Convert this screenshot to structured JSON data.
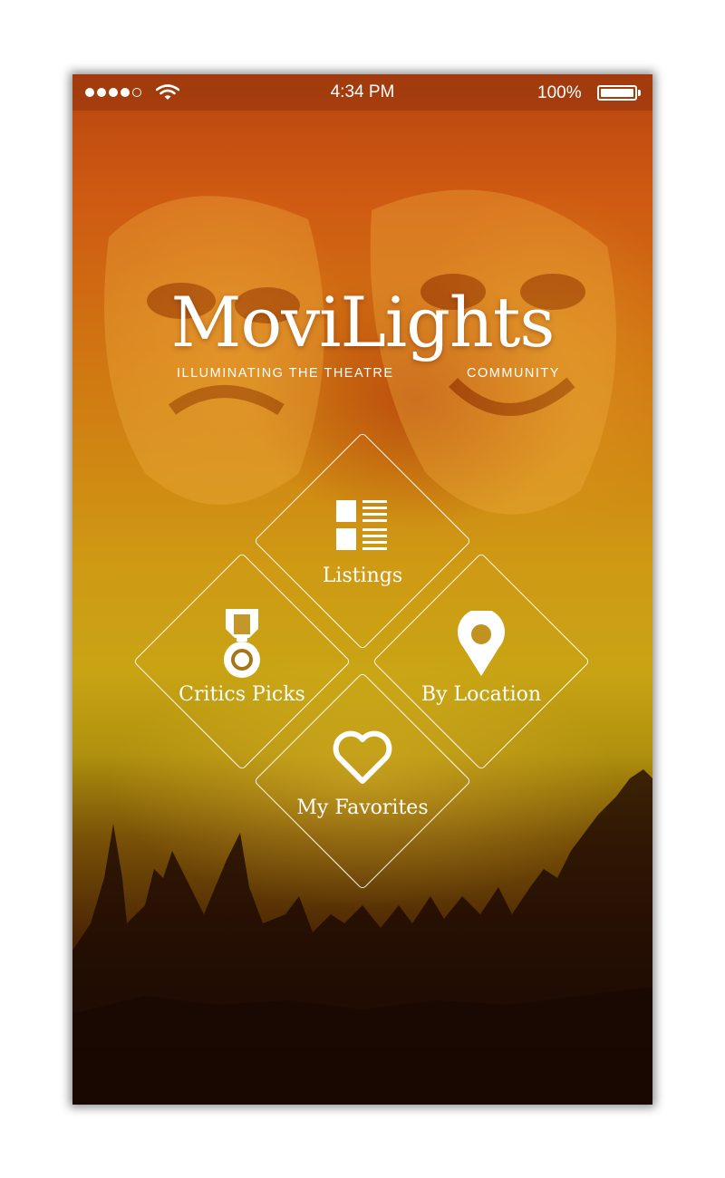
{
  "status_bar": {
    "time": "4:34 PM",
    "battery": "100%",
    "signal_bars": 5,
    "signal_filled": 4
  },
  "brand": {
    "name": "MoviLights",
    "tagline_left": "ILLUMINATING THE THEATRE",
    "tagline_right": "COMMUNITY"
  },
  "menu": {
    "listings": {
      "label": "Listings",
      "icon": "list-grid-icon"
    },
    "critics_picks": {
      "label": "Critics Picks",
      "icon": "medal-icon"
    },
    "by_location": {
      "label": "By Location",
      "icon": "map-pin-icon"
    },
    "my_favorites": {
      "label": "My Favorites",
      "icon": "heart-icon"
    }
  },
  "colors": {
    "accent": "#ffffff",
    "background_top": "#b84410",
    "background_mid": "#c8a414",
    "background_bottom": "#2a1004"
  }
}
